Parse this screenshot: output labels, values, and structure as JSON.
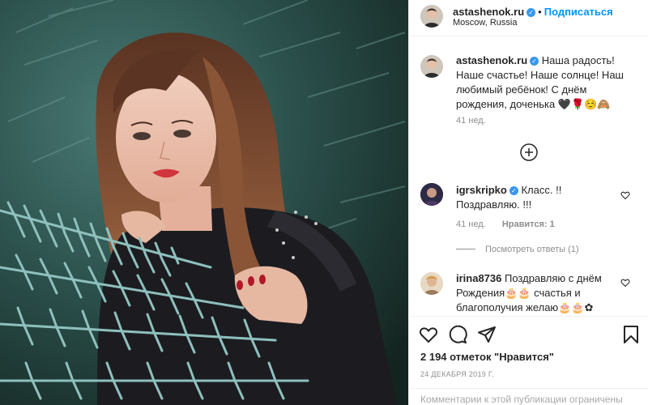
{
  "post": {
    "author": {
      "username": "astashenok.ru",
      "location": "Moscow, Russia",
      "follow_label": "Подписаться",
      "verified": true
    },
    "caption": {
      "username": "astashenok.ru",
      "text": "Наша радость! Наше счастье! Наше солнце! Наш любимый ребёнок! С днём рождения, доченька 🖤🌹☺️🙈",
      "age": "41 нед."
    },
    "load_more_icon": "plus-circle-icon",
    "comments": [
      {
        "username": "igrskripko",
        "text": "Класс. !! Поздравляю. !!!",
        "age": "41 нед.",
        "likes": "Нравится: 1",
        "view_replies": "Посмотреть ответы (1)"
      },
      {
        "username": "irina8736",
        "text": "Поздравляю с днём Рождения🎂🎂 счастья и благополучия желаю🎂🎂✿"
      }
    ],
    "likes_text": "2 194 отметок \"Нравится\"",
    "date": "24 декабря 2019 г.",
    "comments_disabled": "Комментарии к этой публикации ограничены"
  },
  "colors": {
    "accent": "#0095f6",
    "verified": "#3897f0",
    "muted": "#8e8e8e"
  },
  "icons": [
    "heart-icon",
    "comment-icon",
    "share-icon",
    "bookmark-icon",
    "verified-icon"
  ]
}
